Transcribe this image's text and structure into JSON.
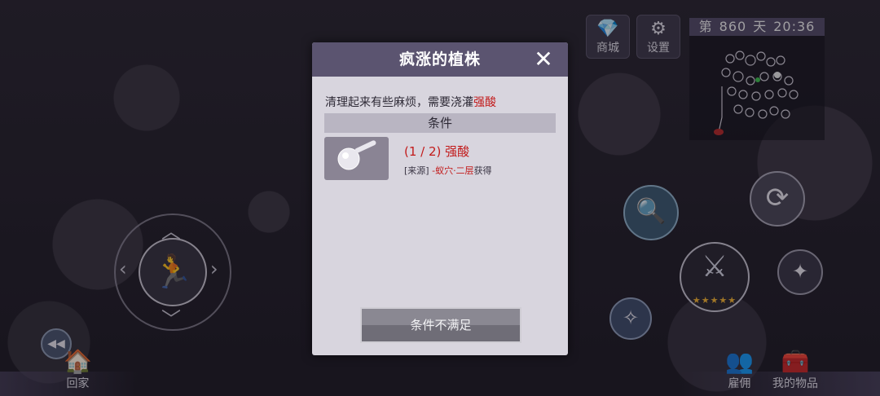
{
  "topbar": {
    "shop_label": "商城",
    "shop_icon": "diamond-icon",
    "settings_label": "设置",
    "settings_icon": "gear-icon"
  },
  "minimap": {
    "day_prefix": "第",
    "day_number": "860",
    "day_suffix": "天",
    "time": "20:36"
  },
  "dialog": {
    "title": "疯涨的植株",
    "description_prefix": "清理起来有些麻烦，需要浇灌",
    "description_highlight": "强酸",
    "conditions_header": "条件",
    "item": {
      "count": "(1 / 2) 强酸",
      "source_prefix": "[来源] ",
      "source_location": "-蚁穴·二层",
      "source_suffix": "获得",
      "icon": "flask-icon"
    },
    "action_label": "条件不满足"
  },
  "hud": {
    "home_label": "回家",
    "hire_label": "雇佣",
    "items_label": "我的物品",
    "weapon_stars": "★★★★★"
  },
  "colors": {
    "header": "#5b5470",
    "highlight": "#c21a1a",
    "dialog_bg": "#d8d5de"
  }
}
